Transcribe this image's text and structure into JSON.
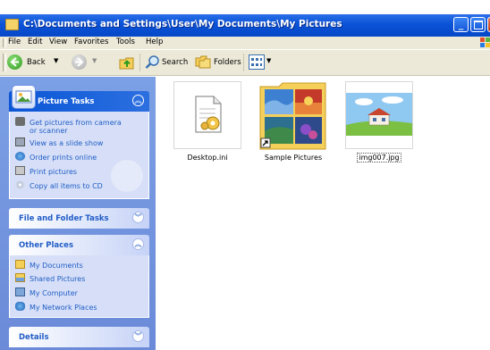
{
  "window": {
    "title": "C:\\Documents and Settings\\User\\My Documents\\My Pictures"
  },
  "menu": [
    "File",
    "Edit",
    "View",
    "Favorites",
    "Tools",
    "Help"
  ],
  "toolbar": {
    "back_label": "Back",
    "search_label": "Search",
    "folders_label": "Folders"
  },
  "left_pane": {
    "picture_tasks": {
      "title": "Picture Tasks",
      "items": [
        {
          "line1": "Get pictures from camera",
          "line2": "or scanner",
          "icon": "camera-icon"
        },
        {
          "label": "View as a slide show",
          "icon": "slideshow-icon"
        },
        {
          "label": "Order prints online",
          "icon": "globe-icon"
        },
        {
          "label": "Print pictures",
          "icon": "printer-icon"
        },
        {
          "label": "Copy all items to CD",
          "icon": "cd-icon"
        }
      ]
    },
    "file_folder_tasks": {
      "title": "File and Folder Tasks"
    },
    "other_places": {
      "title": "Other Places",
      "items": [
        {
          "label": "My Documents",
          "icon": "folder-icon"
        },
        {
          "label": "Shared Pictures",
          "icon": "shared-pictures-icon"
        },
        {
          "label": "My Computer",
          "icon": "computer-icon"
        },
        {
          "label": "My Network Places",
          "icon": "network-icon"
        }
      ]
    },
    "details": {
      "title": "Details"
    }
  },
  "files": [
    {
      "name": "Desktop.ini",
      "icon": "settings-file-icon"
    },
    {
      "name": "Sample Pictures",
      "icon": "folder-thumbnail-icon"
    },
    {
      "name": "img007.jpg",
      "icon": "image-thumbnail-icon"
    }
  ],
  "colors": {
    "titlebar": "#0a52d6",
    "task_pane": "#7ca0e5",
    "link": "#215dc6",
    "chrome": "#ece9d8"
  }
}
